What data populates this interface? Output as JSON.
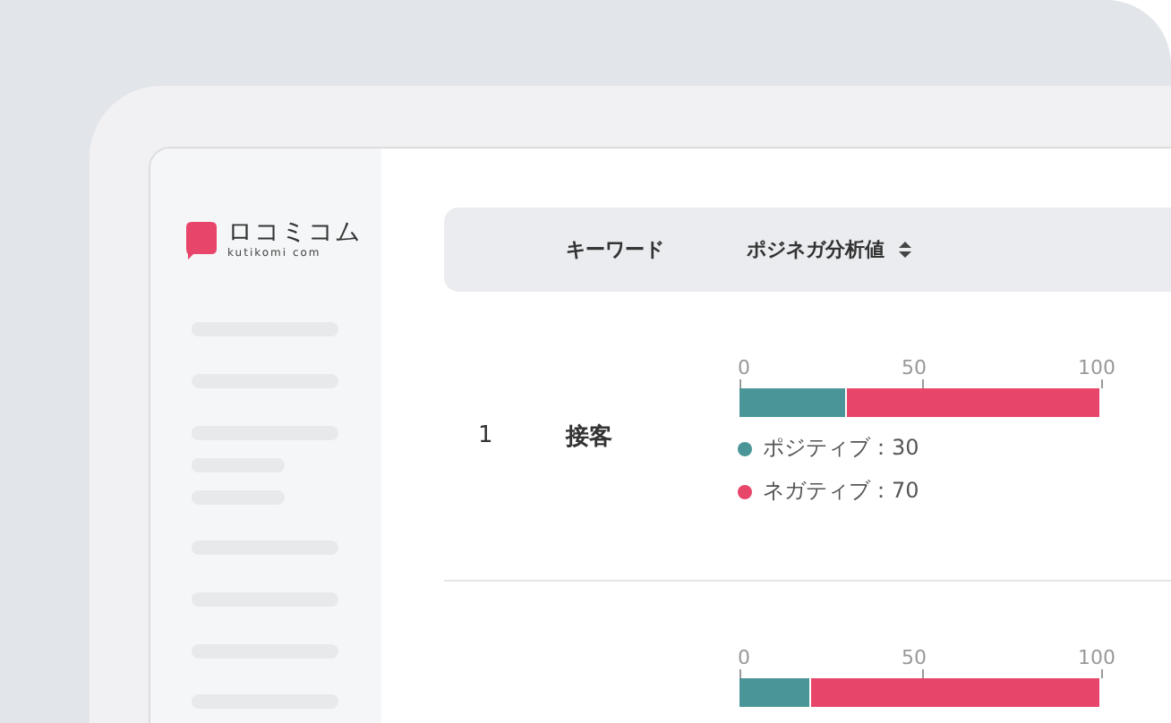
{
  "logo": {
    "name": "ロコミコム",
    "domain": "kutikomi com"
  },
  "table": {
    "columns": [
      {
        "label": "キーワード",
        "sortable": false
      },
      {
        "label": "ポジネガ分析値",
        "sortable": true
      }
    ],
    "rows": [
      {
        "rank": "1",
        "keyword": "接客",
        "scale": [
          "0",
          "50",
          "100"
        ],
        "bar": {
          "level": 0.3
        },
        "legend": [
          {
            "label": "ポジティブ：30",
            "color": "#4a9598"
          },
          {
            "label": "ネガティブ：70",
            "color": "#e8456a"
          }
        ]
      },
      {
        "scale": [
          "0",
          "50",
          "100"
        ],
        "bar": {
          "level": 0.2
        }
      }
    ]
  }
}
